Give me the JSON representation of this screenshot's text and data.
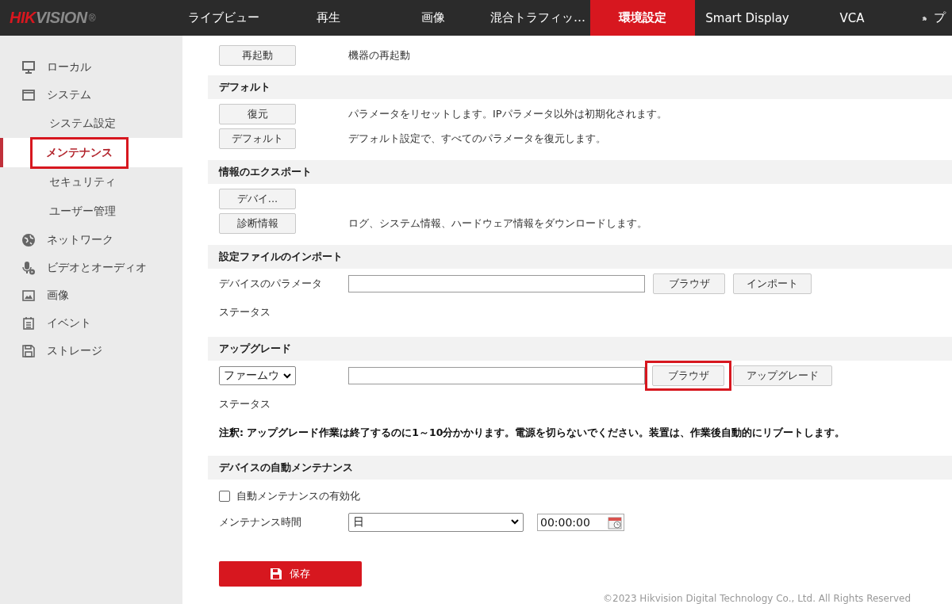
{
  "header": {
    "logo": "HIKVISION",
    "logo_mark": "®",
    "tabs": [
      {
        "label": "ライブビュー",
        "selected": false
      },
      {
        "label": "再生",
        "selected": false
      },
      {
        "label": "画像",
        "selected": false
      },
      {
        "label": "混合トラフィッ…",
        "selected": false
      },
      {
        "label": "環境設定",
        "selected": true
      },
      {
        "label": "Smart Display",
        "selected": false
      },
      {
        "label": "VCA",
        "selected": false
      },
      {
        "label": "プ",
        "selected": false,
        "kind": "plugin"
      }
    ]
  },
  "sidebar": {
    "items": [
      {
        "label": "ローカル",
        "selected": false
      },
      {
        "label": "システム",
        "selected": false,
        "children": [
          {
            "label": "システム設定",
            "selected": false,
            "highlighted": false
          },
          {
            "label": "メンテナンス",
            "selected": true,
            "highlighted": true
          },
          {
            "label": "セキュリティ",
            "selected": false,
            "highlighted": false
          },
          {
            "label": "ユーザー管理",
            "selected": false,
            "highlighted": false
          }
        ]
      },
      {
        "label": "ネットワーク",
        "selected": false
      },
      {
        "label": "ビデオとオーディオ",
        "selected": false
      },
      {
        "label": "画像",
        "selected": false
      },
      {
        "label": "イベント",
        "selected": false
      },
      {
        "label": "ストレージ",
        "selected": false
      }
    ]
  },
  "top_rows": [
    {
      "button": "再起動",
      "description": "機器の再起動"
    }
  ],
  "sections": [
    {
      "title": "デフォルト",
      "rows": [
        {
          "kind": "action",
          "button": "復元",
          "description": "パラメータをリセットします。IPパラメータ以外は初期化されます。"
        },
        {
          "kind": "action",
          "button": "デフォルト",
          "description": "デフォルト設定で、すべてのパラメータを復元します。"
        }
      ]
    },
    {
      "title": "情報のエクスポート",
      "rows": [
        {
          "kind": "action",
          "button": "デバイ..."
        },
        {
          "kind": "action",
          "button": "診断情報",
          "description": "ログ、システム情報、ハードウェア情報をダウンロードします。"
        }
      ]
    },
    {
      "title": "設定ファイルのインポート",
      "rows": [
        {
          "kind": "file",
          "label": "デバイスのパラメータ",
          "buttons": [
            {
              "label": "ブラウザ",
              "highlighted": false
            },
            {
              "label": "インポート",
              "highlighted": false
            }
          ]
        },
        {
          "kind": "status",
          "label": "ステータス"
        }
      ]
    },
    {
      "title": "アップグレード",
      "rows": [
        {
          "kind": "file",
          "select": "ファームウ",
          "buttons": [
            {
              "label": "ブラウザ",
              "highlighted": true
            },
            {
              "label": "アップグレード",
              "highlighted": false
            }
          ]
        },
        {
          "kind": "status",
          "label": "ステータス"
        },
        {
          "kind": "note",
          "text": "注釈: アップグレード作業は終了するのに1～10分かかります。電源を切らないでください。装置は、作業後自動的にリブートします。"
        }
      ]
    },
    {
      "title": "デバイスの自動メンテナンス",
      "rows": [
        {
          "kind": "checkbox",
          "label": "自動メンテナンスの有効化",
          "checked": false
        },
        {
          "kind": "schedule",
          "label": "メンテナンス時間",
          "select": "日",
          "time": "00:00:00"
        }
      ]
    }
  ],
  "save_button": "保存",
  "footer": "©2023 Hikvision Digital Technology Co., Ltd. All Rights Reserved"
}
